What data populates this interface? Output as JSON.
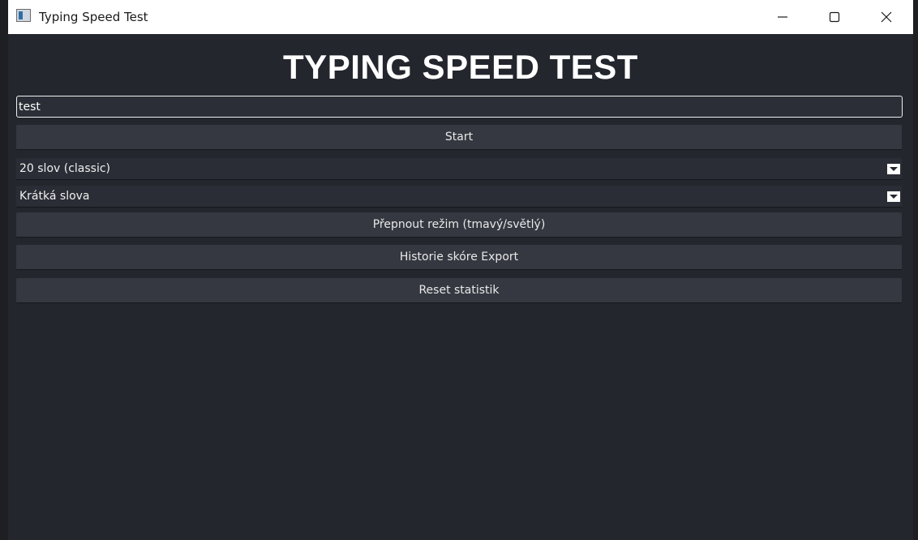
{
  "window": {
    "title": "Typing Speed Test",
    "icon": "app-window-icon",
    "controls": {
      "minimize": "minimize-icon",
      "maximize": "maximize-icon",
      "close": "close-icon"
    }
  },
  "main": {
    "heading": "TYPING SPEED TEST",
    "input_value": "test",
    "start_label": "Start",
    "mode_select": {
      "selected": "20 slov (classic)"
    },
    "word_type_select": {
      "selected": "Krátká slova"
    },
    "theme_toggle_label": "Přepnout režim (tmavý/světlý)",
    "history_label": "Historie skóre  Export",
    "reset_label": "Reset statistik"
  },
  "colors": {
    "background": "#23262d",
    "button": "#353840",
    "select": "#2a2d35",
    "text": "#ffffff"
  }
}
